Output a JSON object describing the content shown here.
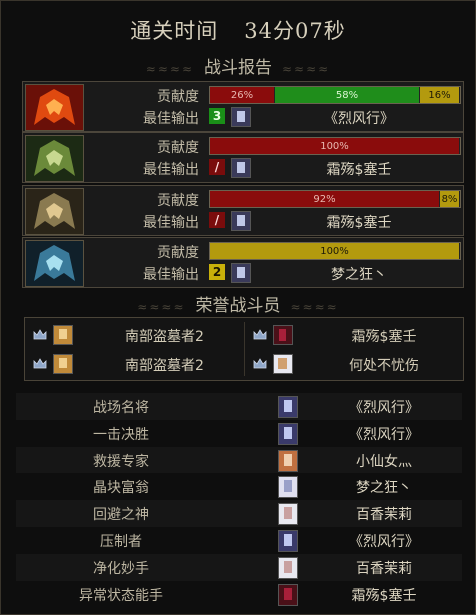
{
  "header": {
    "title_label": "通关时间",
    "title_time": "34分07秒"
  },
  "sections": {
    "battle_report": "战斗报告",
    "honor_fighters": "荣誉战斗员"
  },
  "labels": {
    "contribution": "贡献度",
    "best_output": "最佳输出"
  },
  "players": [
    {
      "portrait": "red-helmet-portrait-icon",
      "contribution": [
        {
          "percent": 26,
          "label": "26%",
          "color": "red"
        },
        {
          "percent": 58,
          "label": "58%",
          "color": "green"
        },
        {
          "percent": 16,
          "label": "16%",
          "color": "gold"
        }
      ],
      "best": {
        "badge": "3",
        "badge_color": "green",
        "icon": "character-thumb-icon",
        "name": "《烈风行》"
      }
    },
    {
      "portrait": "green-helmet-portrait-icon",
      "contribution": [
        {
          "percent": 100,
          "label": "100%",
          "color": "red"
        }
      ],
      "best": {
        "badge": "/",
        "badge_color": "red",
        "icon": "character-thumb-icon",
        "name": "霜殇$塞壬"
      }
    },
    {
      "portrait": "gold-helmet-portrait-icon",
      "contribution": [
        {
          "percent": 92,
          "label": "92%",
          "color": "red"
        },
        {
          "percent": 8,
          "label": "8%",
          "color": "gold"
        }
      ],
      "best": {
        "badge": "/",
        "badge_color": "red",
        "icon": "character-thumb-icon",
        "name": "霜殇$塞壬"
      }
    },
    {
      "portrait": "blue-helmet-portrait-icon",
      "contribution": [
        {
          "percent": 100,
          "label": "100%",
          "color": "gold"
        }
      ],
      "best": {
        "badge": "2",
        "badge_color": "gold",
        "icon": "character-thumb-icon",
        "name": "梦之狂丶"
      }
    }
  ],
  "honor": [
    {
      "name": "南部盗墓者2",
      "side": "left"
    },
    {
      "name": "霜殇$塞壬",
      "side": "right"
    },
    {
      "name": "南部盗墓者2",
      "side": "left"
    },
    {
      "name": "何处不忧伤",
      "side": "right"
    }
  ],
  "awards": [
    {
      "award": "战场名将",
      "player": "《烈风行》"
    },
    {
      "award": "一击决胜",
      "player": "《烈风行》"
    },
    {
      "award": "救援专家",
      "player": "小仙女灬"
    },
    {
      "award": "晶块富翁",
      "player": "梦之狂丶"
    },
    {
      "award": "回避之神",
      "player": "百香茉莉"
    },
    {
      "award": "压制者",
      "player": "《烈风行》"
    },
    {
      "award": "净化妙手",
      "player": "百香茉莉"
    },
    {
      "award": "异常状态能手",
      "player": "霜殇$塞壬"
    }
  ],
  "colors": {
    "red": "#8a0c0c",
    "green": "#1f8d1b",
    "gold": "#b39a0e",
    "accent": "#c9c2ad"
  }
}
